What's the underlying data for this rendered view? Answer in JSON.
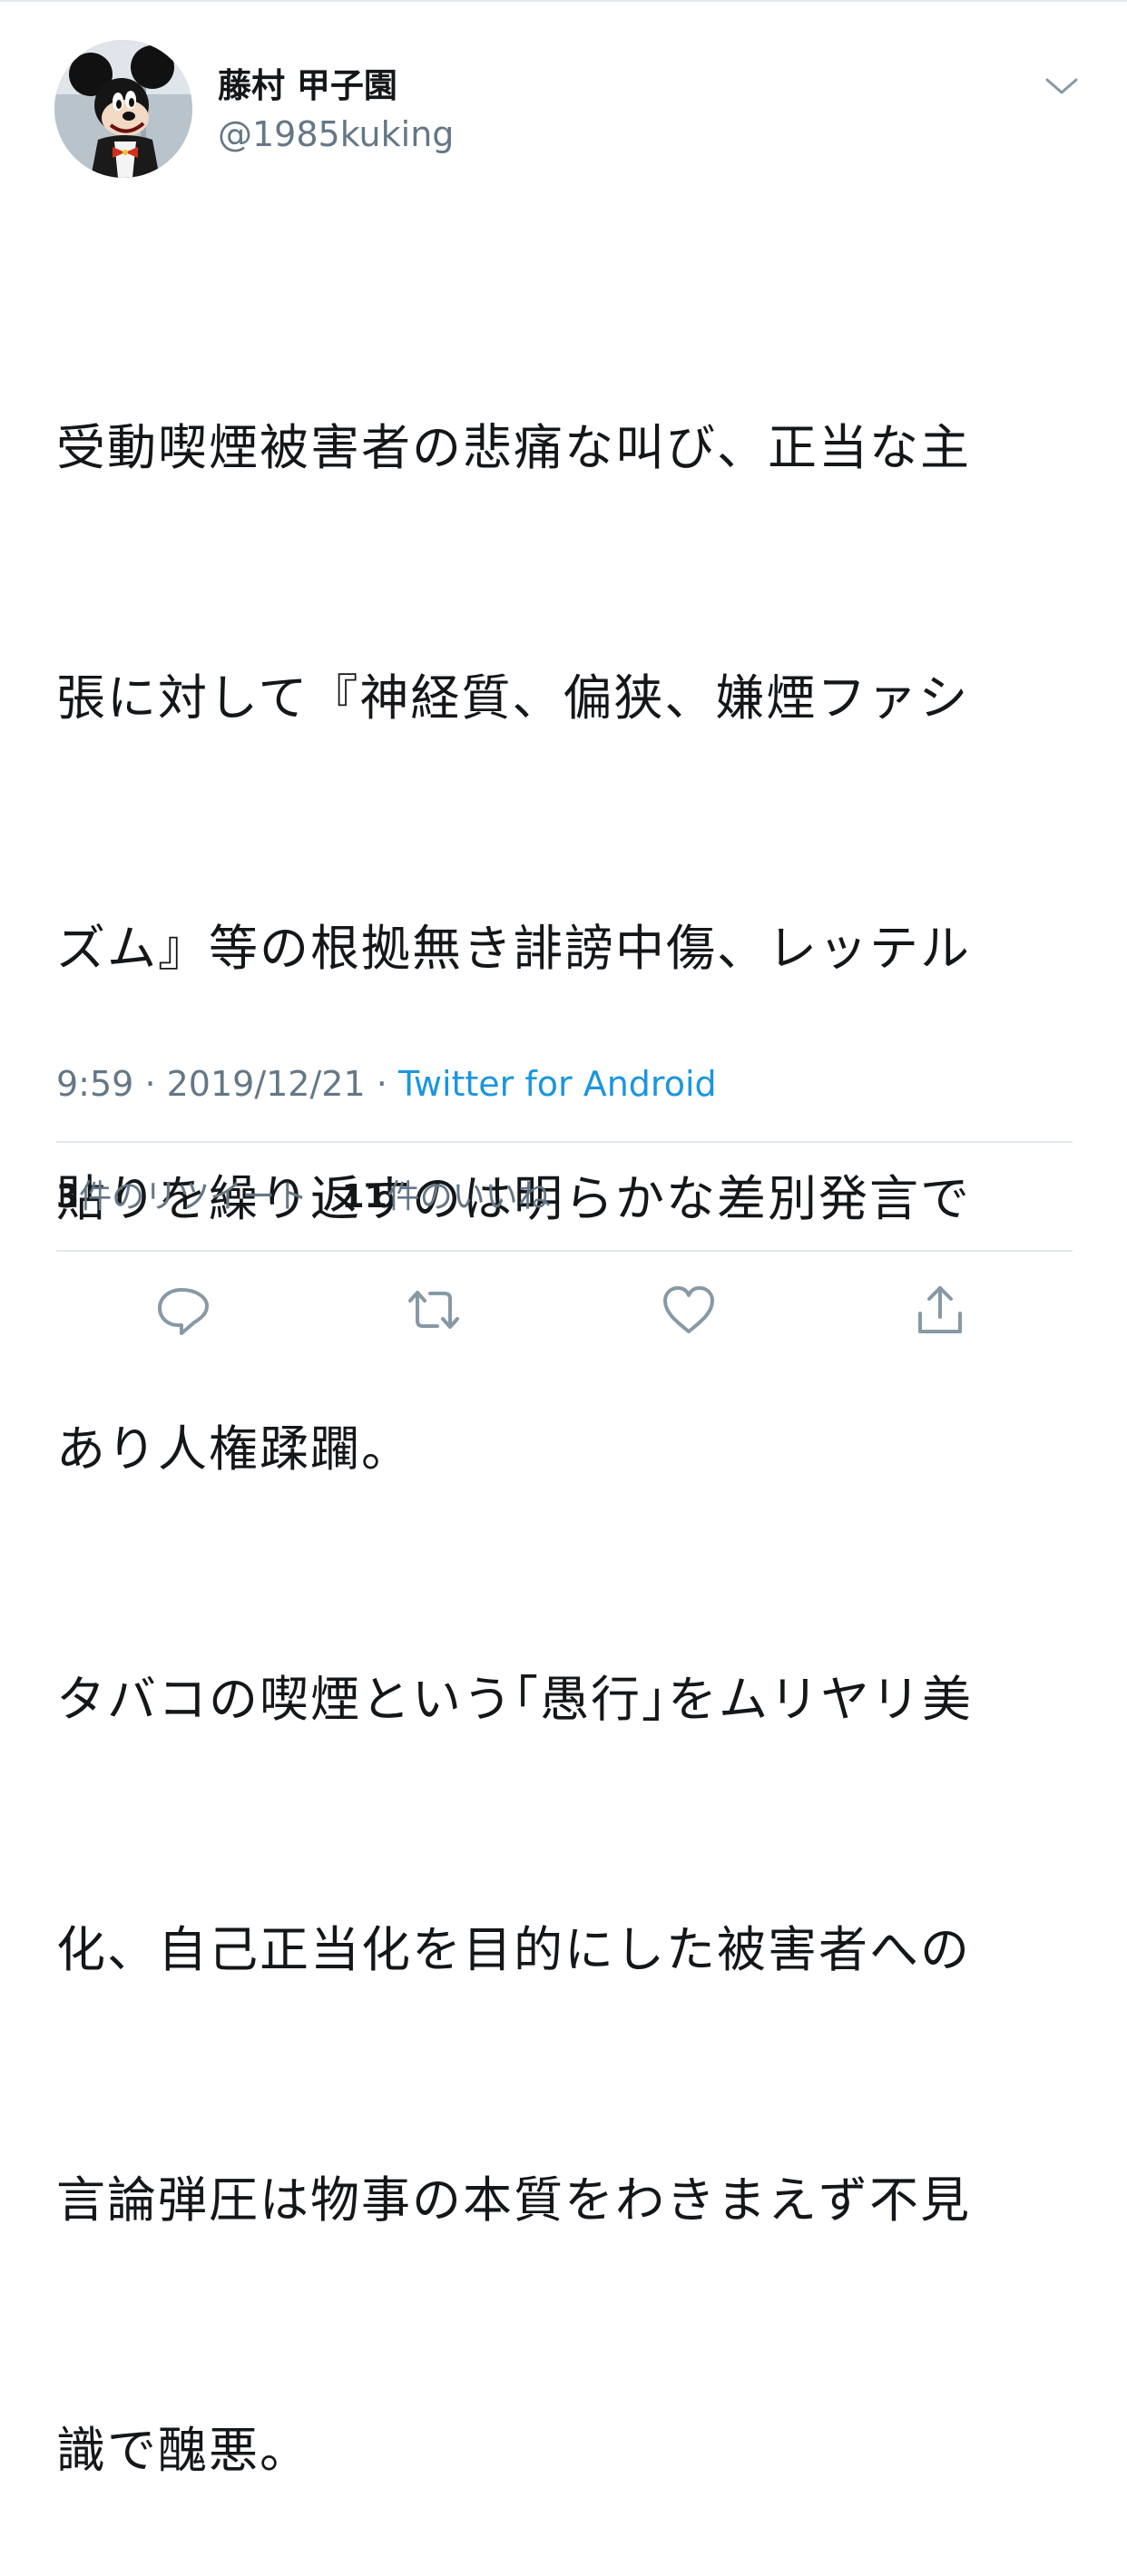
{
  "tweet": {
    "author": {
      "display_name": "藤村 甲子園",
      "handle": "@1985kuking",
      "avatar_icon": "mickey-avatar-icon"
    },
    "menu_icon": "chevron-down-icon",
    "body_lines": [
      "受動喫煙被害者の悲痛な叫び、正当な主",
      "張に対して『神経質、偏狭、嫌煙ファシ",
      "ズム』等の根拠無き誹謗中傷、レッテル",
      "貼りを繰り返すのは明らかな差別発言で",
      "あり人権蹂躙。",
      "タバコの喫煙という｢愚行｣をムリヤリ美",
      "化、自己正当化を目的にした被害者への",
      "言論弾圧は物事の本質をわきまえず不見",
      "識で醜悪。"
    ],
    "time": "9:59",
    "date": "2019/12/21",
    "separator": "·",
    "source": "Twitter for Android",
    "stats": {
      "retweets_count": "3",
      "retweets_label": "件のリツイート",
      "likes_count": "11",
      "likes_label": "件のいいね"
    },
    "actions": [
      "reply-icon",
      "retweet-icon",
      "like-icon",
      "share-icon"
    ]
  },
  "colors": {
    "text": "#14171a",
    "secondary": "#657786",
    "link": "#1b95e0",
    "divider": "#e1e8ed"
  }
}
